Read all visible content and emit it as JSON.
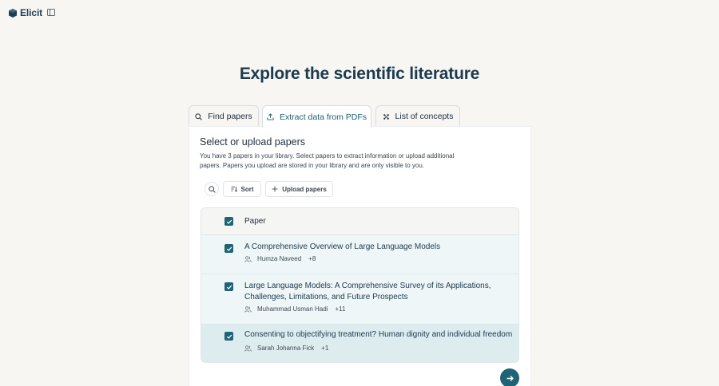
{
  "app": {
    "brand": "Elicit"
  },
  "headline": "Explore the scientific literature",
  "tabs": [
    {
      "label": "Find papers",
      "icon": "search-icon"
    },
    {
      "label": "Extract data from PDFs",
      "icon": "upload-icon",
      "active": true
    },
    {
      "label": "List of concepts",
      "icon": "concepts-icon"
    }
  ],
  "panel": {
    "title": "Select or upload papers",
    "description": "You have 3 papers in your library. Select papers to extract information or upload additional papers. Papers you upload are stored in your library and are only visible to you.",
    "toolbar": {
      "sort_label": "Sort",
      "upload_label": "Upload papers"
    },
    "table": {
      "header": "Paper",
      "rows": [
        {
          "title": "A Comprehensive Overview of Large Language Models",
          "author": "Humza Naveed",
          "more": "+8",
          "checked": true
        },
        {
          "title": "Large Language Models: A Comprehensive Survey of its Applications, Challenges, Limitations, and Future Prospects",
          "author": "Muhammad Usman Hadi",
          "more": "+11",
          "checked": true
        },
        {
          "title": "Consenting to objectifying treatment? Human dignity and individual freedom",
          "author": "Sarah Johanna Fick",
          "more": "+1",
          "checked": true
        }
      ]
    }
  },
  "colors": {
    "accent": "#1f6377",
    "background": "#f7f6f3",
    "row_selected": "#eef6f7",
    "row_highlight": "#dcecef"
  }
}
